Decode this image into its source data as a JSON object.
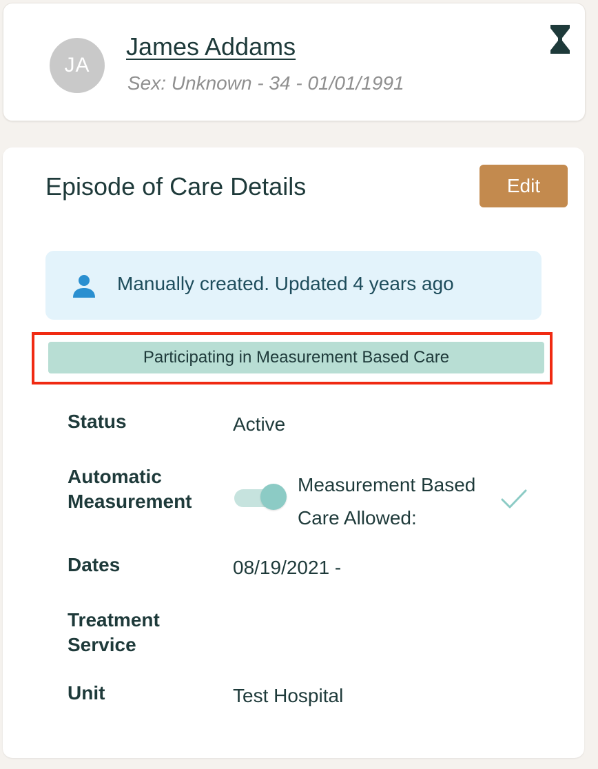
{
  "patient": {
    "initials": "JA",
    "name": "James Addams",
    "subtitle": "Sex: Unknown - 34 - 01/01/1991",
    "status_icon": "hourglass-icon"
  },
  "episode": {
    "title": "Episode of Care Details",
    "edit_label": "Edit",
    "info": {
      "icon": "user-icon",
      "text": "Manually created. Updated 4 years ago"
    },
    "participation_banner": "Participating in Measurement Based Care",
    "fields": {
      "status_label": "Status",
      "status_value": "Active",
      "automatic_measurement_label": "Automatic Measurement",
      "automatic_measurement_on": true,
      "mbc_allowed_label": "Measurement Based Care Allowed:",
      "mbc_allowed_icon": "checkmark-icon",
      "dates_label": "Dates",
      "dates_value": "08/19/2021 -",
      "treatment_service_label": "Treatment Service",
      "treatment_service_value": "",
      "unit_label": "Unit",
      "unit_value": "Test Hospital"
    }
  },
  "colors": {
    "primary_text": "#1e3a3a",
    "edit_button": "#c38a4e",
    "info_background": "#e3f3fb",
    "banner_background": "#b8ded4",
    "highlight_border": "#f02a12",
    "toggle_knob": "#8ccbc5"
  }
}
